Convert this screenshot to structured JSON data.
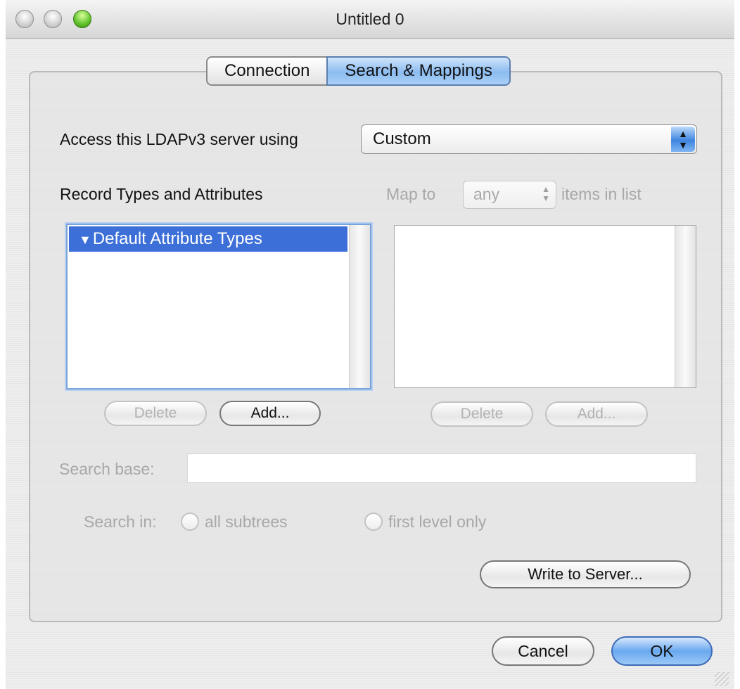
{
  "window": {
    "title": "Untitled 0"
  },
  "tabs": [
    {
      "label": "Connection",
      "selected": false
    },
    {
      "label": "Search & Mappings",
      "selected": true
    }
  ],
  "access": {
    "label": "Access this LDAPv3 server using",
    "selected_value": "Custom"
  },
  "record_types": {
    "label": "Record Types and Attributes",
    "items": [
      "Default Attribute Types"
    ]
  },
  "map_to": {
    "prefix": "Map to",
    "value": "any",
    "suffix": "items in list"
  },
  "left_buttons": {
    "delete": "Delete",
    "add": "Add..."
  },
  "right_buttons": {
    "delete": "Delete",
    "add": "Add..."
  },
  "search_base": {
    "label": "Search base:",
    "value": ""
  },
  "search_in": {
    "label": "Search in:",
    "options": [
      "all subtrees",
      "first level only"
    ]
  },
  "write_button": "Write to Server...",
  "footer": {
    "cancel": "Cancel",
    "ok": "OK"
  },
  "colors": {
    "selection": "#3d6fd8",
    "accent": "#6aa8ef"
  }
}
